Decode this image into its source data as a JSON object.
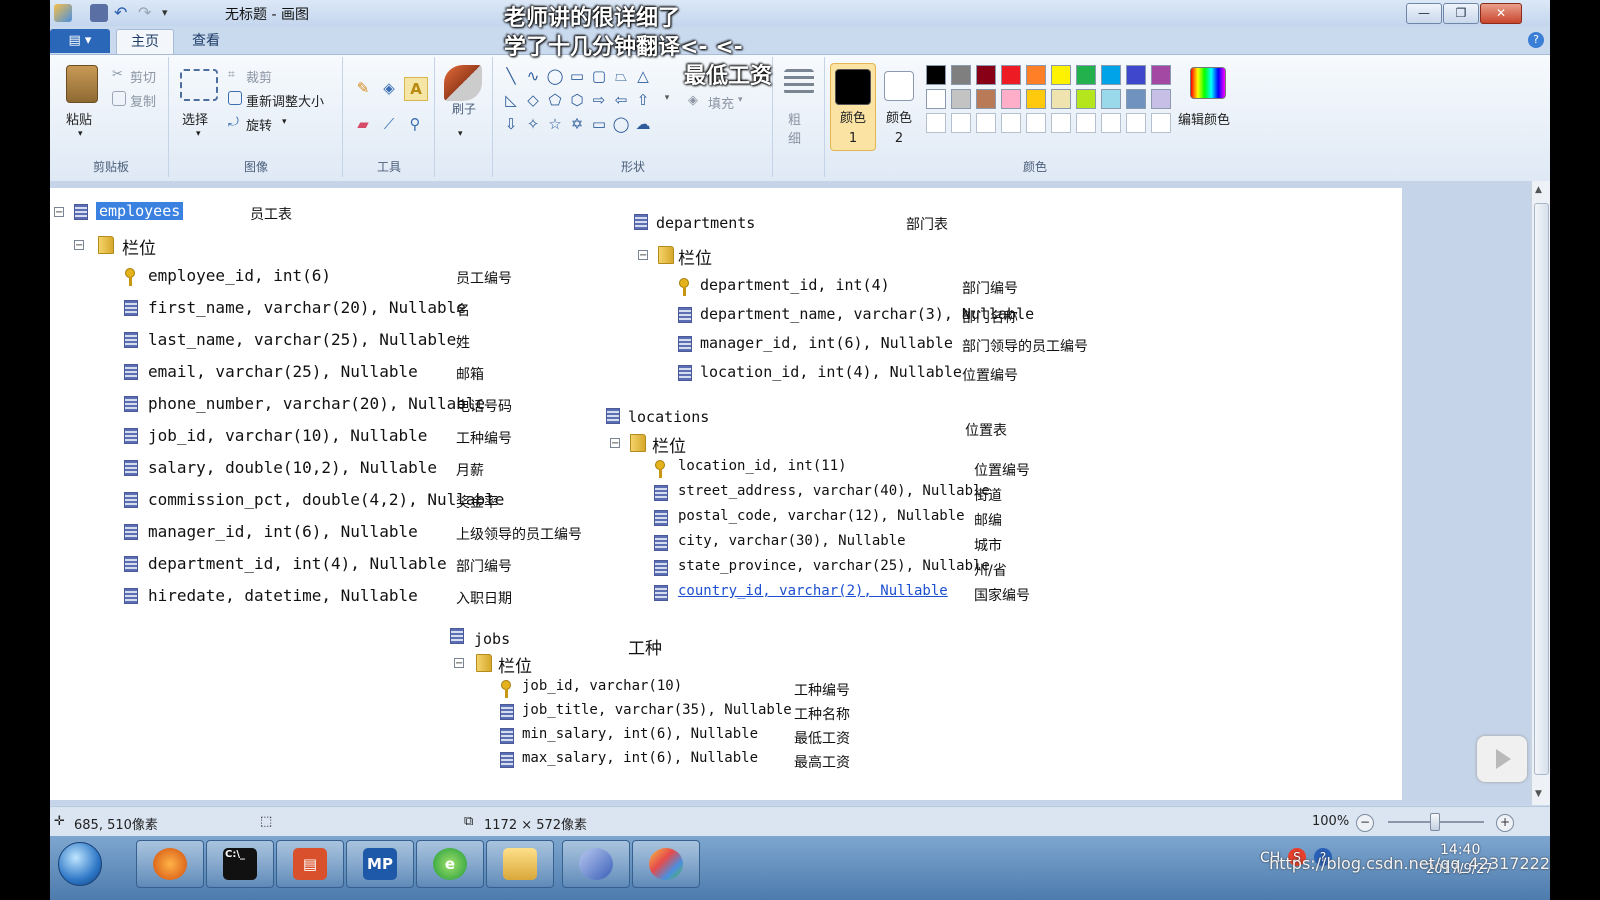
{
  "window": {
    "title": "无标题 - 画图",
    "buttons": {
      "minimize": "—",
      "maximize": "❐",
      "close": "✕"
    }
  },
  "ribbon": {
    "file_tab": "▤ ▾",
    "tabs": [
      "主页",
      "查看"
    ],
    "help": "?",
    "clipboard": {
      "paste": "粘贴",
      "cut": "剪切",
      "copy": "复制",
      "label": "剪贴板"
    },
    "image": {
      "select": "选择",
      "crop": "裁剪",
      "resize": "重新调整大小",
      "rotate": "旋转",
      "label": "图像"
    },
    "tools": {
      "label": "工具"
    },
    "brushes": {
      "label": "刷子"
    },
    "shapes": {
      "fill": "填充",
      "label": "形状"
    },
    "size": {
      "label": "粗细"
    },
    "colors": {
      "color1": "颜色 1",
      "color2": "颜色 2",
      "edit": "编辑颜色",
      "label": "颜色",
      "palette_row1": [
        "#000000",
        "#7f7f7f",
        "#880015",
        "#ed1c24",
        "#ff7f27",
        "#fff200",
        "#22b14c",
        "#00a2e8",
        "#3f48cc",
        "#a349a4"
      ],
      "palette_row2": [
        "#ffffff",
        "#c3c3c3",
        "#b97a57",
        "#ffaec9",
        "#ffc90e",
        "#efe4b0",
        "#b5e61d",
        "#99d9ea",
        "#7092be",
        "#c8bfe7"
      ]
    }
  },
  "subtitles": [
    "老师讲的很详细了",
    "学了十几分钟翻译<- <-",
    "最低工资"
  ],
  "diagram": {
    "employees": {
      "table": "employees",
      "table_cn": "员工表",
      "folder": "栏位",
      "fields": [
        {
          "text": "employee_id, int(6)",
          "cn": "员工编号"
        },
        {
          "text": "first_name, varchar(20), Nullable",
          "cn": "名"
        },
        {
          "text": "last_name, varchar(25), Nullable",
          "cn": "姓"
        },
        {
          "text": "email, varchar(25), Nullable",
          "cn": "邮箱"
        },
        {
          "text": "phone_number, varchar(20), Nullable",
          "cn": "电话号码"
        },
        {
          "text": "job_id, varchar(10), Nullable",
          "cn": "工种编号"
        },
        {
          "text": "salary, double(10,2), Nullable",
          "cn": "月薪"
        },
        {
          "text": "commission_pct, double(4,2), Nullable",
          "cn": "奖金率"
        },
        {
          "text": "manager_id, int(6), Nullable",
          "cn": "上级领导的员工编号"
        },
        {
          "text": "department_id, int(4), Nullable",
          "cn": "部门编号"
        },
        {
          "text": "hiredate, datetime, Nullable",
          "cn": "入职日期"
        }
      ]
    },
    "departments": {
      "table": "departments",
      "table_cn": "部门表",
      "folder": "栏位",
      "fields": [
        {
          "text": "department_id, int(4)",
          "cn": "部门编号"
        },
        {
          "text": "department_name, varchar(3), Nullable",
          "cn": "部门名称"
        },
        {
          "text": "manager_id, int(6), Nullable",
          "cn": "部门领导的员工编号"
        },
        {
          "text": "location_id, int(4), Nullable",
          "cn": "位置编号"
        }
      ]
    },
    "locations": {
      "table": "locations",
      "table_cn": "位置表",
      "folder": "栏位",
      "fields": [
        {
          "text": "location_id, int(11)",
          "cn": "位置编号"
        },
        {
          "text": "street_address, varchar(40), Nullable",
          "cn": "街道"
        },
        {
          "text": "postal_code, varchar(12), Nullable",
          "cn": "邮编"
        },
        {
          "text": "city, varchar(30), Nullable",
          "cn": "城市"
        },
        {
          "text": "state_province, varchar(25), Nullable",
          "cn": "州/省"
        },
        {
          "text": "country_id, varchar(2), Nullable",
          "cn": "国家编号"
        }
      ]
    },
    "jobs": {
      "table": "jobs",
      "table_cn": "工种",
      "folder": "栏位",
      "fields": [
        {
          "text": "job_id, varchar(10)",
          "cn": "工种编号"
        },
        {
          "text": "job_title, varchar(35), Nullable",
          "cn": "工种名称"
        },
        {
          "text": "min_salary, int(6), Nullable",
          "cn": "最低工资"
        },
        {
          "text": "max_salary, int(6), Nullable",
          "cn": "最高工资"
        }
      ]
    }
  },
  "status": {
    "cursor_pos": "685, 510像素",
    "canvas_size": "1172 × 572像素",
    "zoom": "100%"
  },
  "taskbar": {
    "apps": [
      "firefox-icon",
      "cmd-icon",
      "powerpoint-icon",
      "mp-icon",
      "ie-icon",
      "explorer-icon",
      "mysql-icon",
      "paint-icon"
    ],
    "mp_label": "MP",
    "cmd_label": "C:\\_",
    "lang": "CH",
    "time": "14:40",
    "date": "2017/9/27",
    "watermark": "https://blog.csdn.net/qq_42317222"
  }
}
